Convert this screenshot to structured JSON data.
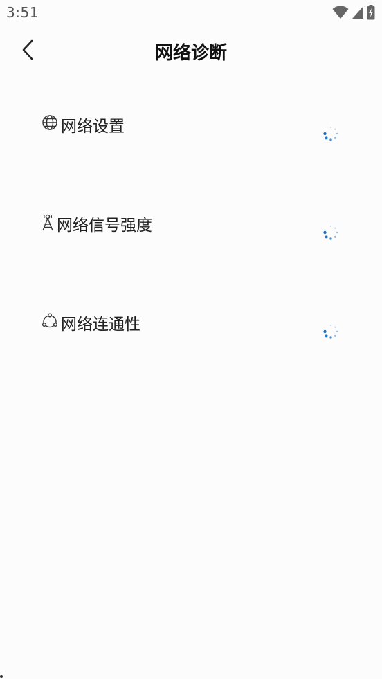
{
  "status_bar": {
    "time": "3:51",
    "icons": [
      "wifi-icon",
      "cell-signal-icon",
      "battery-charging-icon"
    ]
  },
  "header": {
    "back_icon": "chevron-left-icon",
    "title": "网络诊断"
  },
  "items": [
    {
      "icon": "globe-icon",
      "label": "网络设置",
      "status": "loading"
    },
    {
      "icon": "signal-tower-icon",
      "label": "网络信号强度",
      "status": "loading"
    },
    {
      "icon": "connectivity-icon",
      "label": "网络连通性",
      "status": "loading"
    }
  ],
  "colors": {
    "background": "#fcfcfd",
    "spinner": "#1e6fc0",
    "text": "#222222"
  }
}
